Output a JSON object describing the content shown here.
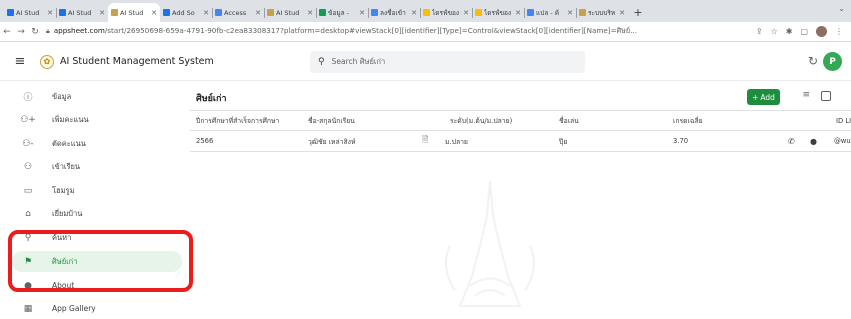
{
  "browser": {
    "tabs": [
      {
        "title": "AI Stud",
        "icon": "appsheet-icon",
        "color": "#1a73e8",
        "active": false
      },
      {
        "title": "AI Stud",
        "icon": "appsheet-icon",
        "color": "#1a73e8",
        "active": false
      },
      {
        "title": "AI Stud",
        "icon": "app-logo-icon",
        "color": "#c8a24a",
        "active": true
      },
      {
        "title": "Add So",
        "icon": "appsheet-icon",
        "color": "#1a73e8",
        "active": false
      },
      {
        "title": "Access",
        "icon": "google-icon",
        "color": "#4285f4",
        "active": false
      },
      {
        "title": "AI Stud",
        "icon": "app-logo-icon",
        "color": "#c8a24a",
        "active": false
      },
      {
        "title": "ข้อมูล - ",
        "icon": "sheets-icon",
        "color": "#0f9d58",
        "active": false
      },
      {
        "title": "ลงชื่อเข้า",
        "icon": "google-icon",
        "color": "#4285f4",
        "active": false
      },
      {
        "title": "ไดรฟ์ของ",
        "icon": "drive-icon",
        "color": "#fbbc04",
        "active": false
      },
      {
        "title": "ไดรฟ์ของ",
        "icon": "drive-icon",
        "color": "#fbbc04",
        "active": false
      },
      {
        "title": "แปล - ค้",
        "icon": "google-icon",
        "color": "#4285f4",
        "active": false
      },
      {
        "title": "ระบบบริห",
        "icon": "app-logo-icon",
        "color": "#c8a24a",
        "active": false
      }
    ],
    "close_glyph": "✕",
    "new_tab_glyph": "+",
    "url_host": "appsheet.com",
    "url_path": "/start/26950698-659a-4791-90fb-c2ea83308317?platform=desktop#viewStack[0][identifier][Type]=Control&viewStack[0][identifier][Name]=ศิษย์..."
  },
  "app": {
    "title": "AI Student Management System",
    "search_placeholder": "Search ศิษย์เก่า",
    "profile_initial": "P",
    "accent_color": "#1e8e3e"
  },
  "sidebar": {
    "items": [
      {
        "label": "ข้อมูล",
        "icon": "info-circle-icon",
        "glyph": "ⓘ",
        "active": false
      },
      {
        "label": "เพิ่มคะแนน",
        "icon": "person-add-icon",
        "glyph": "⚇+",
        "active": false
      },
      {
        "label": "ตัดคะแนน",
        "icon": "person-remove-icon",
        "glyph": "⚇-",
        "active": false
      },
      {
        "label": "เข้าเรียน",
        "icon": "people-icon",
        "glyph": "⚇",
        "active": false
      },
      {
        "label": "โฮมรูม",
        "icon": "classroom-icon",
        "glyph": "▭",
        "active": false
      },
      {
        "label": "เยี่ยมบ้าน",
        "icon": "home-visit-icon",
        "glyph": "⌂",
        "active": false
      },
      {
        "label": "ค้นหา",
        "icon": "search-person-icon",
        "glyph": "⚲",
        "active": false
      },
      {
        "label": "ศิษย์เก่า",
        "icon": "alumni-icon",
        "glyph": "⚑",
        "active": true
      },
      {
        "label": "About",
        "icon": "about-icon",
        "glyph": "●",
        "active": false
      },
      {
        "label": "App Gallery",
        "icon": "grid-icon",
        "glyph": "▦",
        "active": false
      }
    ]
  },
  "view": {
    "title": "ศิษย์เก่า",
    "add_label": "Add",
    "add_glyph": "+",
    "columns": [
      "ปีการศึกษาที่สำเร็จการศึกษา",
      "ชื่อ-สกุลนักเรียน",
      "ระดับ(ม.ต้น/ม.ปลาย)",
      "ชื่อเล่น",
      "เกรดเฉลี่ย",
      "ID LI"
    ],
    "rows": [
      {
        "year": "2566",
        "name": "วุฒิชัย เหล่าสิงห์",
        "level": "ม.ปลาย",
        "nickname": "ปุ๊ย",
        "gpa": "3.70",
        "line_id": "@wu"
      }
    ]
  }
}
